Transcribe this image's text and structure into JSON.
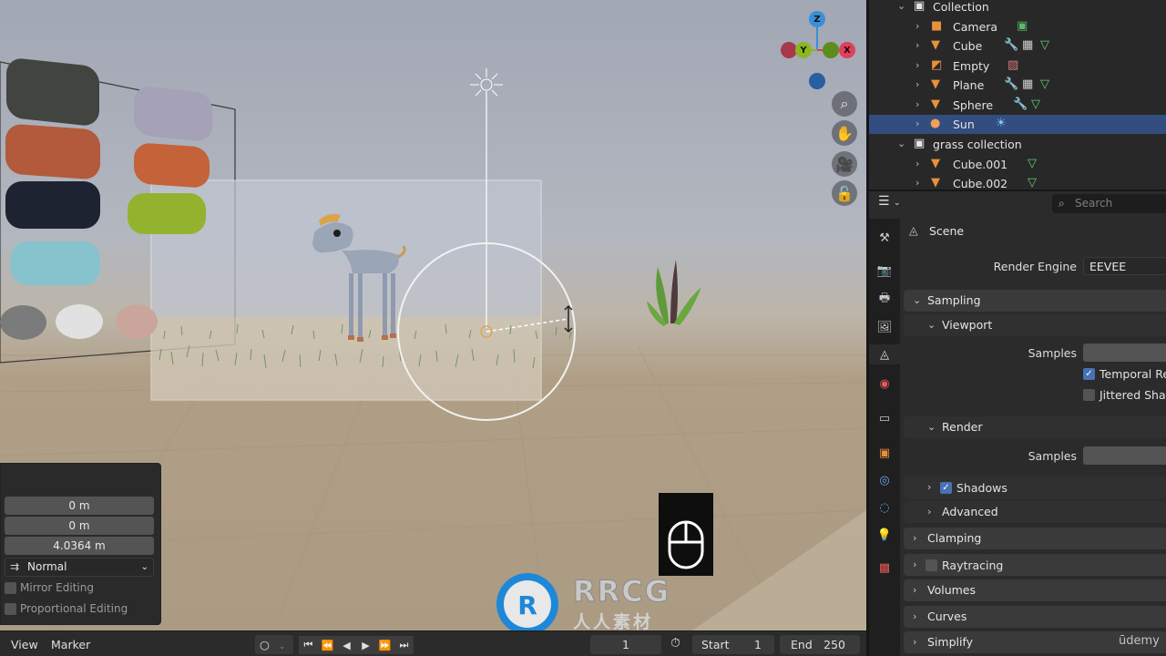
{
  "outliner": {
    "rows": [
      {
        "label": "Collection",
        "icon": "collection-icon",
        "expanded": true,
        "indent": 0
      },
      {
        "label": "Camera",
        "icon": "camera-object-icon",
        "indent": 1
      },
      {
        "label": "Cube",
        "icon": "mesh-object-icon",
        "indent": 1
      },
      {
        "label": "Empty",
        "icon": "empty-object-icon",
        "indent": 1
      },
      {
        "label": "Plane",
        "icon": "mesh-object-icon",
        "indent": 1
      },
      {
        "label": "Sphere",
        "icon": "mesh-object-icon",
        "indent": 1
      },
      {
        "label": "Sun",
        "icon": "light-object-icon",
        "indent": 1,
        "selected": true
      },
      {
        "label": "grass collection",
        "icon": "collection-icon",
        "expanded": true,
        "indent": 0
      },
      {
        "label": "Cube.001",
        "icon": "mesh-object-icon",
        "indent": 1
      },
      {
        "label": "Cube.002",
        "icon": "mesh-object-icon",
        "indent": 1
      }
    ]
  },
  "properties": {
    "search_placeholder": "Search",
    "context_label": "Scene",
    "render_engine_label": "Render Engine",
    "render_engine_value": "EEVEE",
    "panels": {
      "sampling": "Sampling",
      "viewport": "Viewport",
      "viewport_samples_label": "Samples",
      "temporal_reprojection": "Temporal Re",
      "jittered_shadows": "Jittered Shac",
      "render": "Render",
      "render_samples_label": "Samples",
      "shadows": "Shadows",
      "advanced": "Advanced",
      "clamping": "Clamping",
      "raytracing": "Raytracing",
      "volumes": "Volumes",
      "curves": "Curves",
      "simplify": "Simplify"
    },
    "checks": {
      "temporal_reprojection": true,
      "jittered_shadows": false,
      "shadows": true,
      "raytracing": false
    }
  },
  "operator_panel": {
    "field_1": "0 m",
    "field_2": "0 m",
    "field_3": "4.0364 m",
    "orientation": "Normal",
    "mirror_editing": "Mirror Editing",
    "proportional_editing": "Proportional Editing"
  },
  "gizmo": {
    "z": "Z",
    "y": "Y",
    "x": "X"
  },
  "timeline": {
    "view": "View",
    "marker": "Marker",
    "current_frame": "1",
    "start_label": "Start",
    "start_value": "1",
    "end_label": "End",
    "end_value": "250"
  },
  "watermark": {
    "main": "RRCG",
    "sub": "人人素材"
  },
  "udemy": "ūdemy",
  "colors": {
    "selection_row": "#334d80",
    "checkbox_on": "#4772b3",
    "axis_x": "#e0405a",
    "axis_y": "#8ab720",
    "axis_z": "#3a8fd8"
  }
}
